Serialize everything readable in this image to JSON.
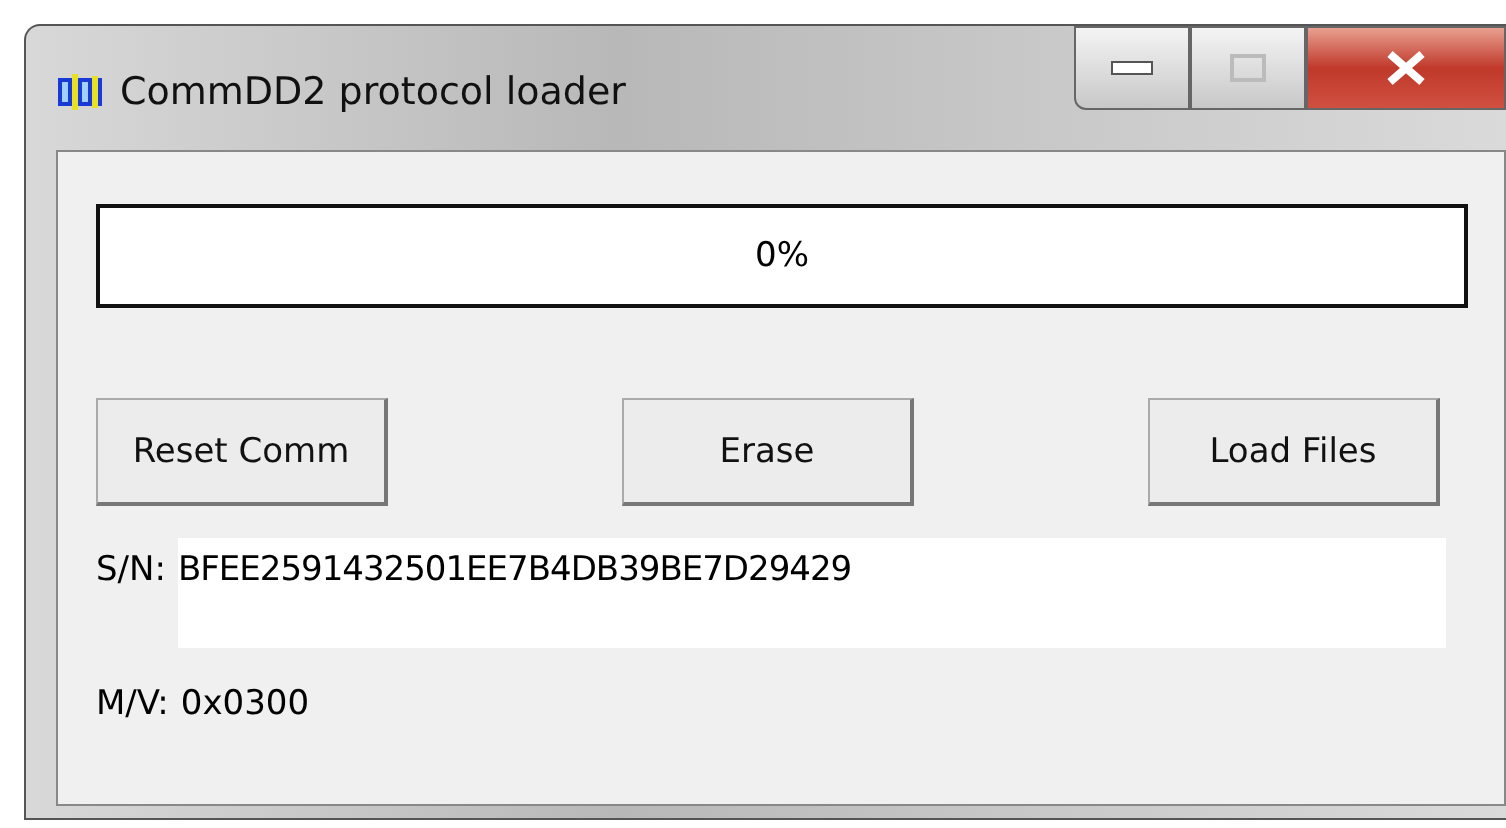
{
  "window": {
    "title": "CommDD2 protocol loader"
  },
  "progress": {
    "level": 0,
    "reading": "0%"
  },
  "buttons": [
    "Reset Comm",
    "Erase",
    "Load Files"
  ],
  "serial": {
    "label": "S/N:",
    "value": "BFEE2591432501EE7B4DB39BE7D29429"
  },
  "version": {
    "label": "M/V:",
    "value": "0x0300"
  }
}
